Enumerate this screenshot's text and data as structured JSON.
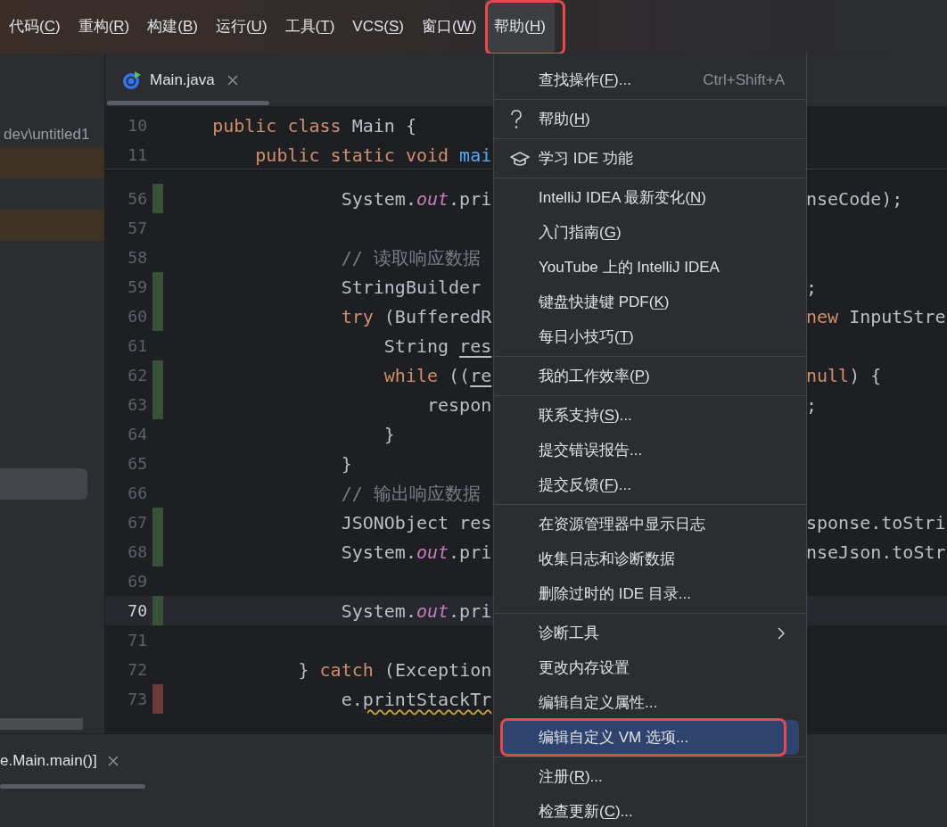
{
  "menu_bar": [
    {
      "label": "代码(C)",
      "selected": false,
      "outlined": false
    },
    {
      "label": "重构(R)",
      "selected": false,
      "outlined": false
    },
    {
      "label": "构建(B)",
      "selected": false,
      "outlined": false
    },
    {
      "label": "运行(U)",
      "selected": false,
      "outlined": false
    },
    {
      "label": "工具(T)",
      "selected": false,
      "outlined": false
    },
    {
      "label": "VCS(S)",
      "selected": false,
      "outlined": false
    },
    {
      "label": "窗口(W)",
      "selected": false,
      "outlined": false
    },
    {
      "label": "帮助(H)",
      "selected": true,
      "outlined": true
    }
  ],
  "project_panel": {
    "path": "dev\\untitled1"
  },
  "editor_tab": {
    "label": "Main.java",
    "selected": true
  },
  "sticky_lines": [
    {
      "number": "10",
      "tokens": [
        {
          "text": "    public class ",
          "kind": "keyword"
        },
        {
          "text": "Main {",
          "kind": "plain"
        }
      ]
    },
    {
      "number": "11",
      "tokens": [
        {
          "text": "        public static void ",
          "kind": "keyword"
        },
        {
          "text": "mai",
          "kind": "method"
        }
      ]
    }
  ],
  "code_lines": [
    {
      "number": "56",
      "added": true,
      "removed": false,
      "current": false,
      "tokens": [
        {
          "text": "                System.",
          "kind": "plain"
        },
        {
          "text": "out",
          "kind": "field"
        },
        {
          "text": ".pri",
          "kind": "plain"
        }
      ],
      "tail": [
        {
          "text": "nseCode);",
          "kind": "plain"
        }
      ]
    },
    {
      "number": "57",
      "added": false,
      "removed": false,
      "current": false
    },
    {
      "number": "58",
      "added": false,
      "removed": false,
      "current": false,
      "tokens": [
        {
          "text": "                // 读取响应数据",
          "kind": "comment"
        }
      ]
    },
    {
      "number": "59",
      "added": true,
      "removed": false,
      "current": false,
      "tokens": [
        {
          "text": "                StringBuilder",
          "kind": "plain"
        }
      ],
      "tail": [
        {
          "text": ";",
          "kind": "plain"
        }
      ]
    },
    {
      "number": "60",
      "added": true,
      "removed": false,
      "current": false,
      "tokens": [
        {
          "text": "                try",
          "kind": "keyword"
        },
        {
          "text": " (BufferedR",
          "kind": "plain"
        }
      ],
      "tail": [
        {
          "text": "new",
          "kind": "keyword"
        },
        {
          "text": " InputStre",
          "kind": "plain"
        }
      ]
    },
    {
      "number": "61",
      "added": false,
      "removed": false,
      "current": false,
      "tokens": [
        {
          "text": "                    String ",
          "kind": "plain"
        },
        {
          "text": "res",
          "kind": "variable"
        }
      ]
    },
    {
      "number": "62",
      "added": true,
      "removed": false,
      "current": false,
      "tokens": [
        {
          "text": "                    while",
          "kind": "keyword"
        },
        {
          "text": " ((",
          "kind": "plain"
        },
        {
          "text": "re",
          "kind": "variable"
        }
      ],
      "tail": [
        {
          "text": "null",
          "kind": "keyword"
        },
        {
          "text": ") {",
          "kind": "plain"
        }
      ]
    },
    {
      "number": "63",
      "added": true,
      "removed": false,
      "current": false,
      "tokens": [
        {
          "text": "                        respon",
          "kind": "plain"
        }
      ],
      "tail": [
        {
          "text": ";",
          "kind": "plain"
        }
      ]
    },
    {
      "number": "64",
      "added": false,
      "removed": false,
      "current": false,
      "tokens": [
        {
          "text": "                    }",
          "kind": "plain"
        }
      ]
    },
    {
      "number": "65",
      "added": false,
      "removed": false,
      "current": false,
      "tokens": [
        {
          "text": "                }",
          "kind": "plain"
        }
      ]
    },
    {
      "number": "66",
      "added": false,
      "removed": false,
      "current": false,
      "tokens": [
        {
          "text": "                // 输出响应数据",
          "kind": "comment"
        }
      ]
    },
    {
      "number": "67",
      "added": true,
      "removed": false,
      "current": false,
      "tokens": [
        {
          "text": "                JSONObject res",
          "kind": "plain"
        }
      ],
      "tail": [
        {
          "text": "sponse.toStri",
          "kind": "plain"
        }
      ]
    },
    {
      "number": "68",
      "added": true,
      "removed": false,
      "current": false,
      "tokens": [
        {
          "text": "                System.",
          "kind": "plain"
        },
        {
          "text": "out",
          "kind": "field"
        },
        {
          "text": ".pri",
          "kind": "plain"
        }
      ],
      "tail": [
        {
          "text": "nseJson.toStr",
          "kind": "plain"
        }
      ]
    },
    {
      "number": "69",
      "added": false,
      "removed": false,
      "current": false
    },
    {
      "number": "70",
      "added": true,
      "removed": false,
      "current": true,
      "tokens": [
        {
          "text": "                System.",
          "kind": "plain"
        },
        {
          "text": "out",
          "kind": "field"
        },
        {
          "text": ".pri",
          "kind": "plain"
        }
      ]
    },
    {
      "number": "71",
      "added": false,
      "removed": false,
      "current": false
    },
    {
      "number": "72",
      "added": false,
      "removed": false,
      "current": false,
      "tokens": [
        {
          "text": "            } ",
          "kind": "plain"
        },
        {
          "text": "catch",
          "kind": "keyword"
        },
        {
          "text": " (Exception",
          "kind": "plain"
        }
      ]
    },
    {
      "number": "73",
      "added": false,
      "removed": true,
      "current": false,
      "tokens": [
        {
          "text": "                e.",
          "kind": "plain"
        },
        {
          "text": "printStackTr",
          "kind": "warning"
        }
      ]
    }
  ],
  "bottom_tab": {
    "label": "e.Main.main()]"
  },
  "help_menu": {
    "groups": [
      [
        {
          "label": "查找操作(F)...",
          "shortcut": "Ctrl+Shift+A",
          "kind": "plain",
          "selected": false,
          "outlined": false
        }
      ],
      [
        {
          "label": "帮助(H)",
          "kind": "help",
          "selected": false,
          "outlined": false
        }
      ],
      [
        {
          "label": "学习 IDE 功能",
          "kind": "learn",
          "selected": false,
          "outlined": false
        }
      ],
      [
        {
          "label": "IntelliJ IDEA 最新变化(N)",
          "kind": "plain",
          "selected": false,
          "outlined": false
        },
        {
          "label": "入门指南(G)",
          "kind": "plain",
          "selected": false,
          "outlined": false
        },
        {
          "label": "YouTube 上的 IntelliJ IDEA",
          "kind": "plain",
          "selected": false,
          "outlined": false
        },
        {
          "label": "键盘快捷键 PDF(K)",
          "kind": "plain",
          "selected": false,
          "outlined": false
        },
        {
          "label": "每日小技巧(T)",
          "kind": "plain",
          "selected": false,
          "outlined": false
        }
      ],
      [
        {
          "label": "我的工作效率(P)",
          "kind": "plain",
          "selected": false,
          "outlined": false
        }
      ],
      [
        {
          "label": "联系支持(S)...",
          "kind": "plain",
          "selected": false,
          "outlined": false
        },
        {
          "label": "提交错误报告...",
          "kind": "plain",
          "selected": false,
          "outlined": false
        },
        {
          "label": "提交反馈(F)...",
          "kind": "plain",
          "selected": false,
          "outlined": false
        }
      ],
      [
        {
          "label": "在资源管理器中显示日志",
          "kind": "plain",
          "selected": false,
          "outlined": false
        },
        {
          "label": "收集日志和诊断数据",
          "kind": "plain",
          "selected": false,
          "outlined": false
        },
        {
          "label": "删除过时的 IDE 目录...",
          "kind": "plain",
          "selected": false,
          "outlined": false
        }
      ],
      [
        {
          "label": "诊断工具",
          "kind": "submenu",
          "selected": false,
          "outlined": false
        },
        {
          "label": "更改内存设置",
          "kind": "plain",
          "selected": false,
          "outlined": false
        },
        {
          "label": "编辑自定义属性...",
          "kind": "plain",
          "selected": false,
          "outlined": false
        },
        {
          "label": "编辑自定义 VM 选项...",
          "kind": "plain",
          "selected": true,
          "outlined": true
        }
      ],
      [
        {
          "label": "注册(R)...",
          "kind": "plain",
          "selected": false,
          "outlined": false
        },
        {
          "label": "检查更新(C)...",
          "kind": "plain",
          "selected": false,
          "outlined": false
        }
      ]
    ]
  }
}
